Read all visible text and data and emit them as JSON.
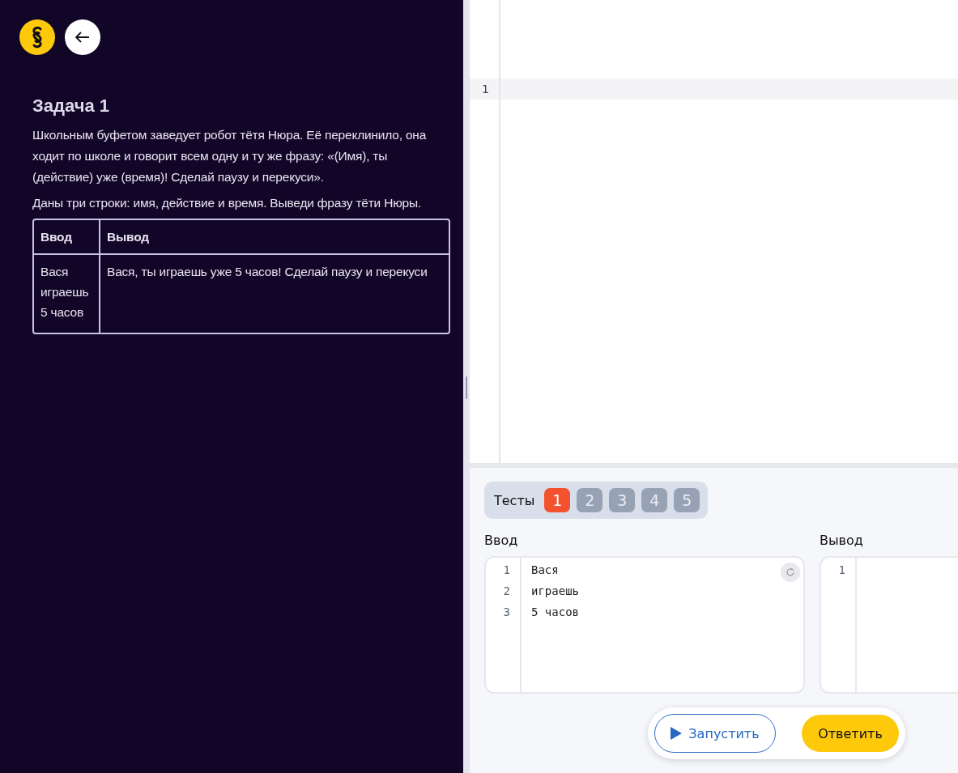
{
  "task": {
    "title": "Задача 1",
    "paragraphs": [
      "Школьным буфетом заведует робот тётя Нюра. Её переклинило, она ходит по школе и говорит всем одну и ту же фразу: «(Имя), ты (действие) уже (время)! Сделай паузу и перекуси».",
      "Даны три строки: имя, действие и время. Выведи фразу тёти Нюры."
    ],
    "table": {
      "columns": [
        "Ввод",
        "Вывод"
      ],
      "rows": [
        {
          "input_lines": [
            "Вася",
            "играешь",
            "5 часов"
          ],
          "output": "Вася, ты играешь уже 5 часов! Сделай паузу и перекуси"
        }
      ]
    }
  },
  "editor": {
    "line_numbers": [
      "1"
    ]
  },
  "tests": {
    "label": "Тесты",
    "items": [
      {
        "label": "1",
        "selected": true
      },
      {
        "label": "2",
        "selected": false
      },
      {
        "label": "3",
        "selected": false
      },
      {
        "label": "4",
        "selected": false
      },
      {
        "label": "5",
        "selected": false
      }
    ]
  },
  "io": {
    "input": {
      "label": "Ввод",
      "lines": [
        {
          "number": "1",
          "text": "Вася"
        },
        {
          "number": "2",
          "text": "играешь"
        },
        {
          "number": "3",
          "text": "5 часов"
        }
      ]
    },
    "output": {
      "label": "Вывод",
      "line_numbers": [
        "1"
      ]
    }
  },
  "actions": {
    "run": "Запустить",
    "submit": "Ответить"
  }
}
